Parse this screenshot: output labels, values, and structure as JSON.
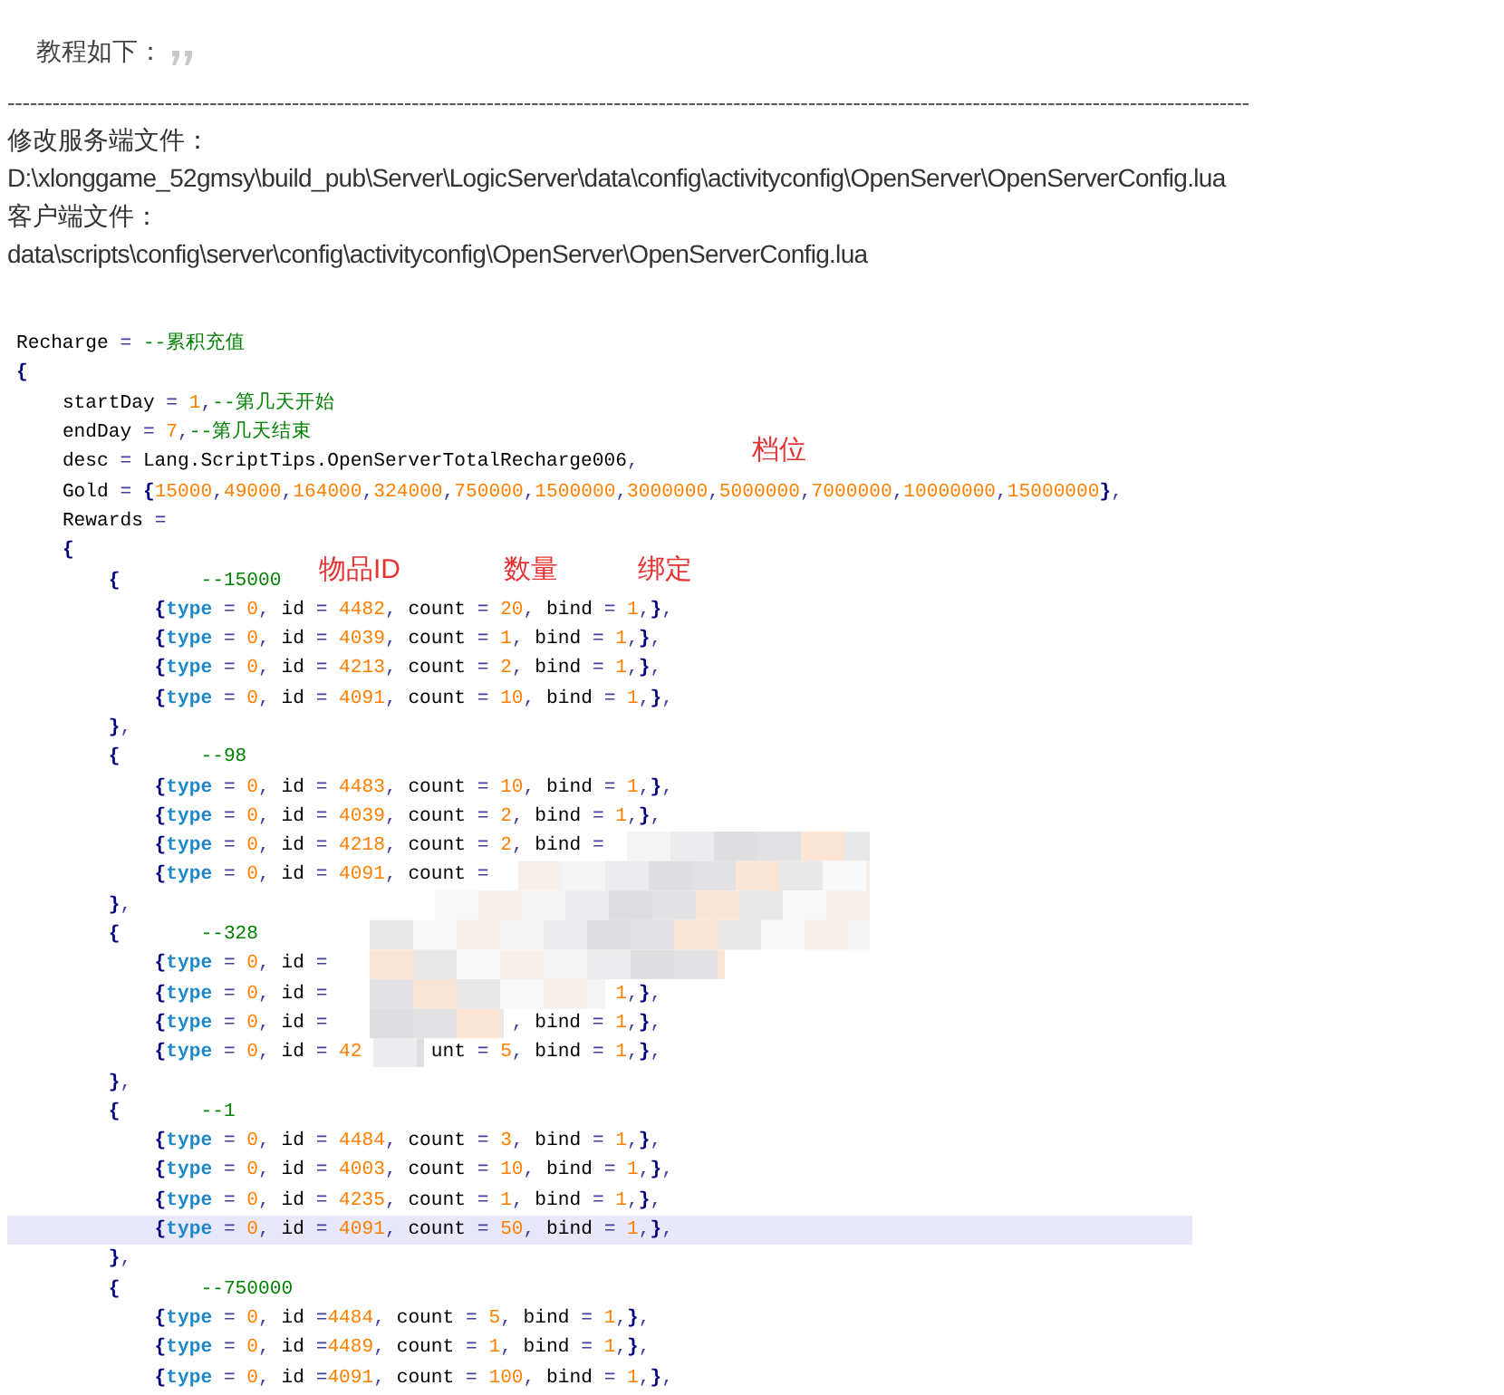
{
  "intro": {
    "text": "教程如下："
  },
  "divider": "----------------------------------------------------------------------------------------------------------------------------------------------------------------------",
  "sections": [
    {
      "label": "修改服务端文件：",
      "path": "D:\\xlonggame_52gmsy\\build_pub\\Server\\LogicServer\\data\\config\\activityconfig\\OpenServer\\OpenServerConfig.lua"
    },
    {
      "label": "客户端文件：",
      "path": "data\\scripts\\config\\server\\config\\activityconfig\\OpenServer\\OpenServerConfig.lua"
    }
  ],
  "code": {
    "lines": [
      {
        "text": "Recharge = --累积充值",
        "highlighted": false
      },
      {
        "text": "{",
        "highlighted": false
      },
      {
        "text": "    startDay = 1,--第几天开始",
        "highlighted": false
      },
      {
        "text": "    endDay = 7,--第几天结束",
        "highlighted": false
      },
      {
        "text": "    desc = Lang.ScriptTips.OpenServerTotalRecharge006,",
        "highlighted": false
      },
      {
        "text": "    Gold = {15000,49000,164000,324000,750000,1500000,3000000,5000000,7000000,10000000,15000000},",
        "highlighted": false
      },
      {
        "text": "    Rewards =",
        "highlighted": false
      },
      {
        "text": "    {",
        "highlighted": false
      },
      {
        "text": "        {       --15000",
        "highlighted": false
      },
      {
        "text": "            {type = 0, id = 4482, count = 20, bind = 1,},",
        "highlighted": false
      },
      {
        "text": "            {type = 0, id = 4039, count = 1, bind = 1,},",
        "highlighted": false
      },
      {
        "text": "            {type = 0, id = 4213, count = 2, bind = 1,},",
        "highlighted": false
      },
      {
        "text": "            {type = 0, id = 4091, count = 10, bind = 1,},",
        "highlighted": false
      },
      {
        "text": "        },",
        "highlighted": false
      },
      {
        "text": "        {       --98",
        "highlighted": false
      },
      {
        "text": "            {type = 0, id = 4483, count = 10, bind = 1,},",
        "highlighted": false
      },
      {
        "text": "            {type = 0, id = 4039, count = 2, bind = 1,},",
        "highlighted": false
      },
      {
        "text": "            {type = 0, id = 4218, count = 2, bind =",
        "highlighted": false
      },
      {
        "text": "            {type = 0, id = 4091, count =",
        "highlighted": false
      },
      {
        "text": "        },",
        "highlighted": false
      },
      {
        "text": "        {       --328",
        "highlighted": false
      },
      {
        "text": "            {type = 0, id =",
        "highlighted": false
      },
      {
        "text": "            {type = 0, id =",
        "tail": "1,},",
        "highlighted": false
      },
      {
        "text": "            {type = 0, id =",
        "tail": ", bind = 1,},",
        "highlighted": false
      },
      {
        "text": "            {type = 0, id = 42",
        "tail": "unt = 5, bind = 1,},",
        "highlighted": false
      },
      {
        "text": "        },",
        "highlighted": false
      },
      {
        "text": "        {       --1",
        "highlighted": false
      },
      {
        "text": "            {type = 0, id = 4484, count = 3, bind = 1,},",
        "highlighted": false
      },
      {
        "text": "            {type = 0, id = 4003, count = 10, bind = 1,},",
        "highlighted": false
      },
      {
        "text": "            {type = 0, id = 4235, count = 1, bind = 1,},",
        "highlighted": false
      },
      {
        "text": "            {type = 0, id = 4091, count = 50, bind = 1,},",
        "highlighted": true
      },
      {
        "text": "        },",
        "highlighted": false
      },
      {
        "text": "        {       --750000",
        "highlighted": false
      },
      {
        "text": "            {type = 0, id =4484, count = 5, bind = 1,},",
        "highlighted": false
      },
      {
        "text": "            {type = 0, id =4489, count = 1, bind = 1,},",
        "highlighted": false
      },
      {
        "text": "            {type = 0, id =4091, count = 100, bind = 1,},",
        "highlighted": false
      }
    ],
    "annotations": [
      {
        "text": "档位"
      },
      {
        "text": "物品ID"
      },
      {
        "text": "数量"
      },
      {
        "text": "绑定"
      }
    ]
  }
}
